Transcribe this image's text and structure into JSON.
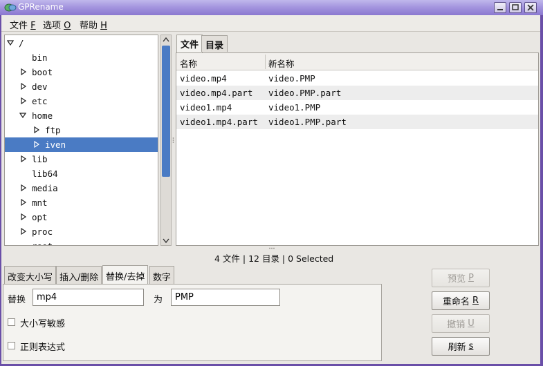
{
  "window": {
    "title": "GPRename"
  },
  "menubar": {
    "items": [
      {
        "label": "文件",
        "accel": "F"
      },
      {
        "label": "选项",
        "accel": "O"
      },
      {
        "label": "帮助",
        "accel": "H"
      }
    ]
  },
  "tree": {
    "items": [
      {
        "label": "/",
        "expanded": true
      },
      {
        "label": "bin"
      },
      {
        "label": "boot",
        "collapsed": true
      },
      {
        "label": "dev",
        "collapsed": true
      },
      {
        "label": "etc",
        "collapsed": true
      },
      {
        "label": "home",
        "expanded": true
      },
      {
        "label": "ftp",
        "collapsed": true
      },
      {
        "label": "iven",
        "collapsed": true,
        "selected": true
      },
      {
        "label": "lib",
        "collapsed": true
      },
      {
        "label": "lib64"
      },
      {
        "label": "media",
        "collapsed": true
      },
      {
        "label": "mnt",
        "collapsed": true
      },
      {
        "label": "opt",
        "collapsed": true
      },
      {
        "label": "proc",
        "collapsed": true
      },
      {
        "label": "root"
      }
    ]
  },
  "right_tabs": [
    {
      "label": "文件",
      "active": true
    },
    {
      "label": "目录"
    }
  ],
  "file_table": {
    "columns": [
      "名称",
      "新名称"
    ],
    "rows": [
      [
        "video.mp4",
        "video.PMP"
      ],
      [
        "video.mp4.part",
        "video.PMP.part"
      ],
      [
        "video1.mp4",
        "video1.PMP"
      ],
      [
        "video1.mp4.part",
        "video1.PMP.part"
      ]
    ]
  },
  "status": "4 文件 | 12 目录 | 0 Selected",
  "bottom_tabs": [
    {
      "label": "改变大小写"
    },
    {
      "label": "插入/删除"
    },
    {
      "label": "替换/去掉",
      "active": true
    },
    {
      "label": "数字"
    }
  ],
  "replace": {
    "replace_label": "替换",
    "replace_value": "mp4",
    "with_label": "为",
    "with_value": "PMP",
    "case_sensitive_label": "大小写敏感",
    "regex_label": "正则表达式"
  },
  "buttons": {
    "preview": {
      "label": "预览",
      "accel": "P"
    },
    "rename": {
      "label": "重命名",
      "accel": "R"
    },
    "undo": {
      "label": "撤销",
      "accel": "U"
    },
    "refresh": {
      "label": "刷新",
      "accel": "s"
    }
  },
  "colors": {
    "selection": "#4a7bc4",
    "titlebar": "#a596df"
  }
}
